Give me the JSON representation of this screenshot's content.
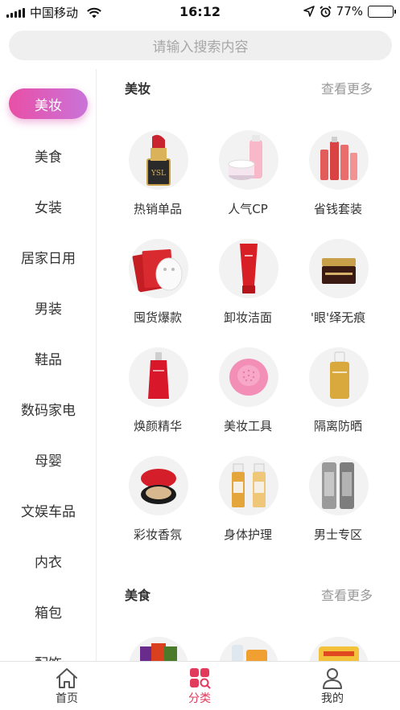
{
  "status_bar": {
    "carrier": "中国移动",
    "time": "16:12",
    "battery": "77%",
    "battery_level": 0.77
  },
  "search": {
    "placeholder": "请输入搜索内容"
  },
  "sidebar": {
    "items": [
      {
        "label": "美妆",
        "active": true
      },
      {
        "label": "美食"
      },
      {
        "label": "女装"
      },
      {
        "label": "居家日用"
      },
      {
        "label": "男装"
      },
      {
        "label": "鞋品"
      },
      {
        "label": "数码家电"
      },
      {
        "label": "母婴"
      },
      {
        "label": "文娱车品"
      },
      {
        "label": "内衣"
      },
      {
        "label": "箱包"
      },
      {
        "label": "配饰"
      }
    ]
  },
  "sections": [
    {
      "title": "美妆",
      "more": "查看更多",
      "items": [
        {
          "label": "热销单品",
          "icon": "lipstick-icon"
        },
        {
          "label": "人气CP",
          "icon": "skincare-set-icon"
        },
        {
          "label": "省钱套装",
          "icon": "bottle-set-icon"
        },
        {
          "label": "囤货爆款",
          "icon": "face-mask-icon"
        },
        {
          "label": "卸妆洁面",
          "icon": "cleanser-tube-icon"
        },
        {
          "label": "'眼'绎无痕",
          "icon": "eye-cream-icon"
        },
        {
          "label": "焕颜精华",
          "icon": "serum-bottle-icon"
        },
        {
          "label": "美妆工具",
          "icon": "cleansing-brush-icon"
        },
        {
          "label": "隔离防晒",
          "icon": "sunscreen-icon"
        },
        {
          "label": "彩妆香氛",
          "icon": "cushion-compact-icon"
        },
        {
          "label": "身体护理",
          "icon": "body-oil-icon"
        },
        {
          "label": "男士专区",
          "icon": "mens-skincare-icon"
        }
      ]
    },
    {
      "title": "美食",
      "more": "查看更多",
      "items": [
        {
          "label": "",
          "icon": "snack-bags-icon"
        },
        {
          "label": "",
          "icon": "drinks-icon"
        },
        {
          "label": "",
          "icon": "bread-icon"
        }
      ]
    }
  ],
  "bottom_nav": [
    {
      "label": "首页",
      "icon": "home-icon"
    },
    {
      "label": "分类",
      "icon": "category-icon",
      "active": true
    },
    {
      "label": "我的",
      "icon": "user-icon"
    }
  ],
  "colors": {
    "accent": "#e23a5c",
    "sidebar_active_start": "#e94fa6",
    "sidebar_active_end": "#c973d9"
  }
}
